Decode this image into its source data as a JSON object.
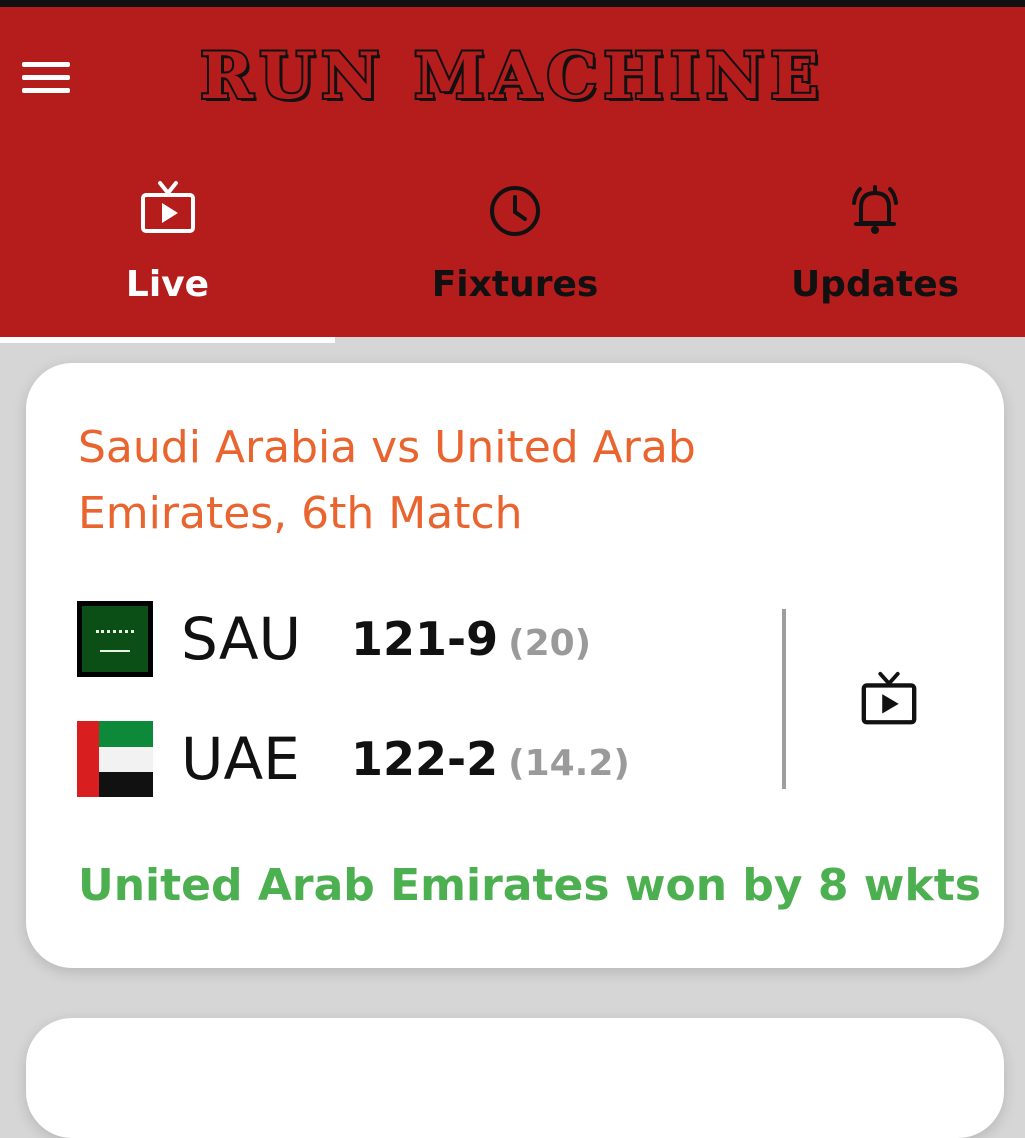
{
  "app": {
    "title": "RUN MACHINE"
  },
  "tabs": [
    {
      "label": "Live",
      "icon": "live-tv-icon",
      "active": true
    },
    {
      "label": "Fixtures",
      "icon": "clock-icon",
      "active": false
    },
    {
      "label": "Updates",
      "icon": "bell-icon",
      "active": false
    }
  ],
  "colors": {
    "header": "#b51c1c",
    "match_title": "#e9642e",
    "result": "#4caf50",
    "overs": "#9a9a9a"
  },
  "match": {
    "title": "Saudi Arabia vs United Arab Emirates, 6th Match",
    "teams": [
      {
        "code": "SAU",
        "flag": "saudi-arabia-flag",
        "score": "121-9",
        "overs": "(20)"
      },
      {
        "code": "UAE",
        "flag": "uae-flag",
        "score": "122-2",
        "overs": "(14.2)"
      }
    ],
    "watch_icon": "live-tv-icon",
    "result": "United Arab Emirates won by 8 wkts"
  }
}
